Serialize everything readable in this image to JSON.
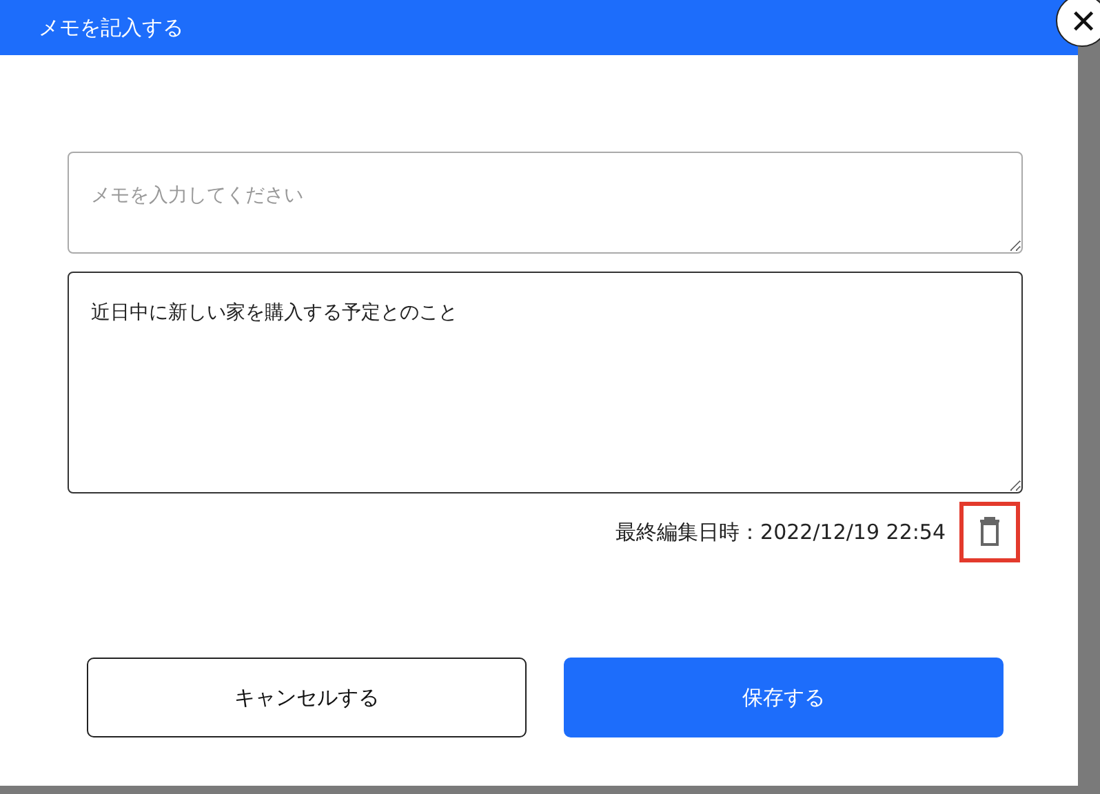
{
  "dialog": {
    "title": "メモを記入する",
    "close_label": "✕"
  },
  "new_memo": {
    "placeholder": "メモを入力してください"
  },
  "saved_memo": {
    "value": "近日中に新しい家を購入する予定とのこと",
    "last_edited": "最終編集日時：2022/12/19 22:54",
    "delete_highlighted": true
  },
  "buttons": [
    {
      "label": "キャンセルする",
      "kind": "secondary"
    },
    {
      "label": "保存する",
      "kind": "primary"
    }
  ]
}
